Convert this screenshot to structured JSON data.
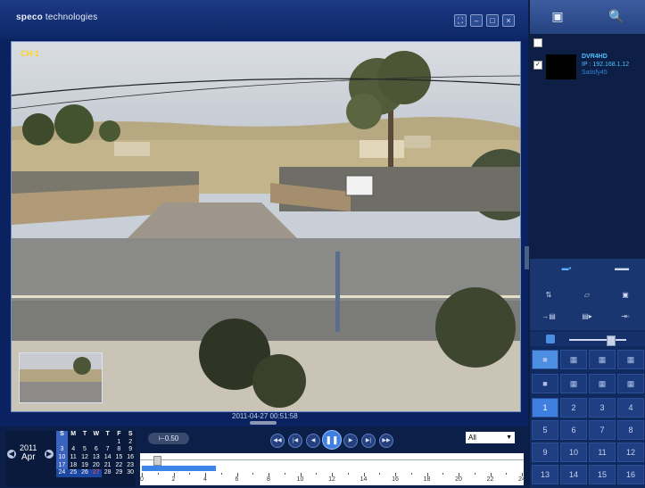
{
  "app": {
    "brand_prefix": "speco",
    "brand_suffix": " technologies"
  },
  "window_controls": {
    "fullscreen": "⛶",
    "minimize": "–",
    "maximize": "□",
    "close": "×"
  },
  "video": {
    "channel_label": "CH-1",
    "timestamp": "2011-04-27 00:51:58"
  },
  "calendar": {
    "year": "2011",
    "month": "Apr",
    "prev": "◀",
    "next": "▶",
    "weekdays": [
      "S",
      "M",
      "T",
      "W",
      "T",
      "F",
      "S"
    ],
    "weeks": [
      [
        "",
        "",
        "",
        "",
        "",
        "1",
        "2"
      ],
      [
        "3",
        "4",
        "5",
        "6",
        "7",
        "8",
        "9"
      ],
      [
        "10",
        "11",
        "12",
        "13",
        "14",
        "15",
        "16"
      ],
      [
        "17",
        "18",
        "19",
        "20",
        "21",
        "22",
        "23"
      ],
      [
        "24",
        "25",
        "26",
        "27",
        "28",
        "29",
        "30"
      ]
    ],
    "recorded_days": [
      "24",
      "25",
      "26",
      "27"
    ],
    "selected_day": "27"
  },
  "playback": {
    "goto_label": "⊢0.50",
    "buttons": [
      "◀◀",
      "|◀",
      "◀",
      "❚❚",
      "▶",
      "▶|",
      "▶▶"
    ],
    "channel_select": "All",
    "timeline": {
      "hours": [
        "0",
        "2",
        "4",
        "6",
        "8",
        "10",
        "12",
        "14",
        "16",
        "18",
        "20",
        "22",
        "24"
      ],
      "recorded_from_hour": 0,
      "recorded_to_hour": 4.7,
      "position_hour": 0.9
    }
  },
  "right_panel": {
    "top_buttons": [
      "▣",
      "🔍"
    ],
    "device": {
      "name": "DVR4HD",
      "ip": "IP : 192.168.1.12",
      "user": "Satisfy45"
    },
    "mode_buttons": [
      "▬▪",
      "▬▬"
    ],
    "tool_rows": [
      [
        "⇅",
        "▱",
        "▣"
      ],
      [
        "→▤",
        "▤▸",
        "⇥◦"
      ]
    ],
    "volume": 0.72,
    "layouts_top": [
      "■",
      "▦",
      "▦",
      "▦"
    ],
    "layouts_bottom": [
      "■",
      "▦",
      "▦",
      "▦"
    ],
    "channels": [
      "1",
      "2",
      "3",
      "4",
      "5",
      "6",
      "7",
      "8",
      "9",
      "10",
      "11",
      "12",
      "13",
      "14",
      "15",
      "16"
    ],
    "selected_channel": "1"
  },
  "colors": {
    "accent": "#3e7fe0",
    "channel_label": "#ffd21f",
    "device_text": "#4fc1ff"
  }
}
